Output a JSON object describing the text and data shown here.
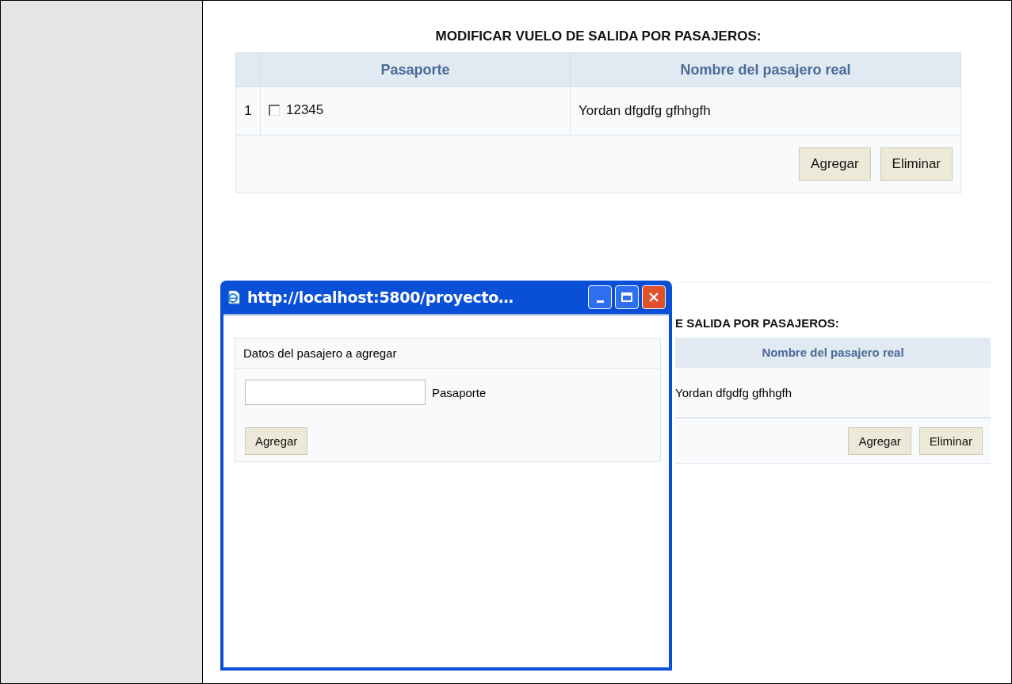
{
  "main_section": {
    "title": "MODIFICAR VUELO DE SALIDA POR PASAJEROS:",
    "columns": [
      "Pasaporte",
      "Nombre del pasajero real"
    ],
    "rows": [
      {
        "index": "1",
        "checked": false,
        "passport": "12345",
        "name": "Yordan dfgdfg gfhhgfh"
      }
    ],
    "buttons": [
      "Agregar",
      "Eliminar"
    ]
  },
  "background_section": {
    "title": "E SALIDA POR PASAJEROS:",
    "column": "Nombre del pasajero real",
    "row_name": "Yordan dfgdfg gfhhgfh",
    "buttons": [
      "Agregar",
      "Eliminar"
    ]
  },
  "popup": {
    "title": "http://localhost:5800/proyecto…",
    "heading": "Datos del pasajero a agregar",
    "field_label": "Pasaporte",
    "button": "Agregar"
  }
}
